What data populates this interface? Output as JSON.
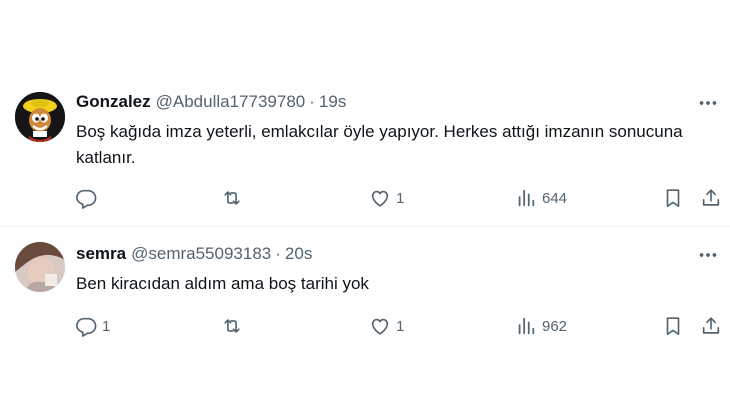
{
  "tweets": [
    {
      "display_name": "Gonzalez",
      "handle": "@Abdulla17739780",
      "separator": "·",
      "time": "19s",
      "text": "Boş kağıda imza yeterli, emlakcılar öyle yapıyor. Herkes attığı imzanın sonucuna katlanır.",
      "reply_count": "",
      "retweet_count": "",
      "like_count": "1",
      "view_count": "644",
      "avatar_icon": "cartoon-character-avatar"
    },
    {
      "display_name": "semra",
      "handle": "@semra55093183",
      "separator": "·",
      "time": "20s",
      "text": "Ben kiracıdan aldım ama boş tarihi yok",
      "reply_count": "1",
      "retweet_count": "",
      "like_count": "1",
      "view_count": "962",
      "avatar_icon": "profile-photo-avatar"
    }
  ],
  "colors": {
    "text_primary": "#0f1419",
    "text_secondary": "#536471",
    "divider": "#eff3f4",
    "background": "#ffffff"
  },
  "icons": [
    "reply-icon",
    "retweet-icon",
    "like-icon",
    "views-icon",
    "bookmark-icon",
    "share-icon",
    "more-icon"
  ]
}
